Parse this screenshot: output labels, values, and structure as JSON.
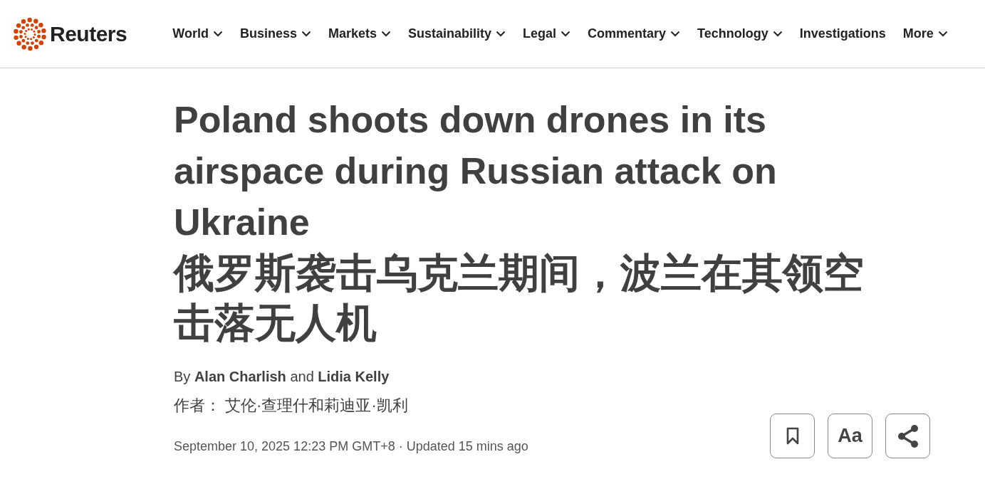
{
  "header": {
    "brand": "Reuters",
    "nav": [
      {
        "label": "World",
        "has_menu": true
      },
      {
        "label": "Business",
        "has_menu": true
      },
      {
        "label": "Markets",
        "has_menu": true
      },
      {
        "label": "Sustainability",
        "has_menu": true
      },
      {
        "label": "Legal",
        "has_menu": true
      },
      {
        "label": "Commentary",
        "has_menu": true
      },
      {
        "label": "Technology",
        "has_menu": true
      },
      {
        "label": "Investigations",
        "has_menu": false
      },
      {
        "label": "More",
        "has_menu": true
      }
    ]
  },
  "article": {
    "headline": "Poland shoots down drones in its airspace during Russian attack on Ukraine",
    "headline_translation": "俄罗斯袭击乌克兰期间，波兰在其领空击落无人机",
    "byline": "By **Alan Charlish** and **Lidia Kelly**",
    "byline_translation": "作者：  艾伦·查理什和莉迪亚·凯利",
    "dateline": "September 10, 2025 12:23 PM GMT+8 · Updated 15 mins ago",
    "tools": [
      {
        "kind": "bookmark"
      },
      {
        "kind": "text_size",
        "label": "Aa"
      },
      {
        "kind": "share"
      }
    ]
  }
}
